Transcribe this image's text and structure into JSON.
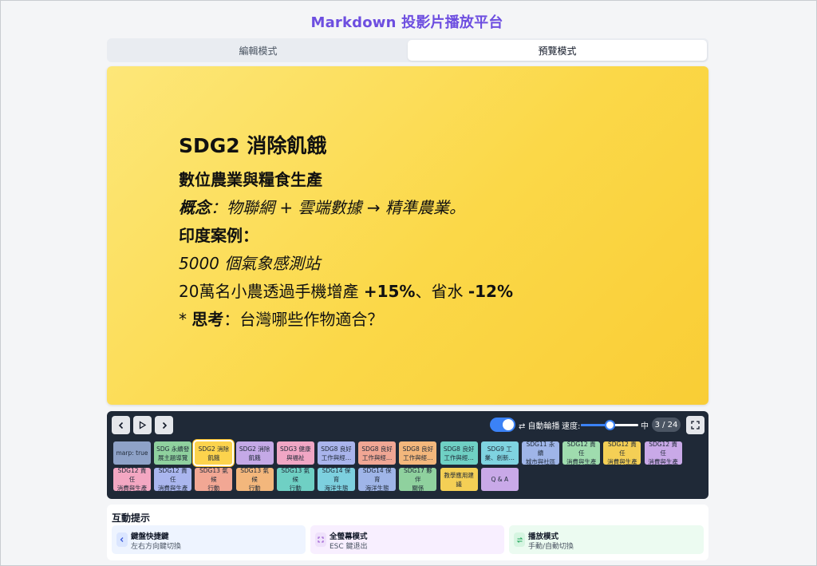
{
  "app": {
    "title": "Markdown 投影片播放平台"
  },
  "tabs": [
    {
      "label": "編輯模式",
      "active": false
    },
    {
      "label": "預覽模式",
      "active": true
    }
  ],
  "slide": {
    "heading": "SDG2 消除飢餓",
    "subheading": "數位農業與糧食生產",
    "concept_label": "概念",
    "concept_text": "：物聯網 + 雲端數據 → 精準農業。",
    "case_label": "印度案例：",
    "case_line1": "5000 個氣象感測站",
    "case_line2_prefix": "20萬名小農透過手機增產 ",
    "case_line2_bold1": "+15%",
    "case_line2_mid": "、省水 ",
    "case_line2_bold2": "-12%",
    "think_prefix": "* ",
    "think_label": "思考",
    "think_text": "：台灣哪些作物適合？",
    "background_color": "#fbd848"
  },
  "controls": {
    "prev_icon": "chevron-left-icon",
    "play_icon": "play-icon",
    "next_icon": "chevron-right-icon",
    "auto_play_on": true,
    "auto_play_label": "⇄ 自動輪播",
    "speed_label": "速度:",
    "speed_value": "中",
    "speed_level": 0.5,
    "counter": "3 / 24",
    "fullscreen_icon": "fullscreen-icon",
    "accent_color": "#3b82f6"
  },
  "thumbnails": [
    {
      "label": "marp: true",
      "color": "#8ea2c8",
      "active": false
    },
    {
      "label": "SDG 永續發\n展主題導覽",
      "color": "#8fd19e",
      "active": false
    },
    {
      "label": "SDG2 消除\n飢餓",
      "color": "#fcd34d",
      "active": true
    },
    {
      "label": "SDG2 消除\n飢餓",
      "color": "#c4a9e6",
      "active": false
    },
    {
      "label": "SDG3 健康\n與福祉",
      "color": "#f0a6c4",
      "active": false
    },
    {
      "label": "SDG8 良好\n工作與經…",
      "color": "#a9b4ec",
      "active": false
    },
    {
      "label": "SDG8 良好\n工作與經…",
      "color": "#f0a694",
      "active": false
    },
    {
      "label": "SDG8 良好\n工作與經…",
      "color": "#f3b77c",
      "active": false
    },
    {
      "label": "SDG8 良好\n工作與經…",
      "color": "#6fd0c4",
      "active": false
    },
    {
      "label": "SDG9 工\n業、創新…",
      "color": "#7fd3e0",
      "active": false
    },
    {
      "label": "SDG11 永續\n城市與社區",
      "color": "#9fb5e8",
      "active": false
    },
    {
      "label": "SDG12 責任\n消費與生產",
      "color": "#9fdcae",
      "active": false
    },
    {
      "label": "SDG12 責任\n消費與生產",
      "color": "#f4cf55",
      "active": false
    },
    {
      "label": "SDG12 責任\n消費與生產",
      "color": "#c9a9e8",
      "active": false
    },
    {
      "label": "SDG12 責任\n消費與生產",
      "color": "#f3a7c2",
      "active": false
    },
    {
      "label": "SDG12 責任\n消費與生產",
      "color": "#aab6ee",
      "active": false
    },
    {
      "label": "SDG13 氣候\n行動",
      "color": "#f2a794",
      "active": false
    },
    {
      "label": "SDG13 氣候\n行動",
      "color": "#f3b77c",
      "active": false
    },
    {
      "label": "SDG13 氣候\n行動",
      "color": "#6fd0c4",
      "active": false
    },
    {
      "label": "SDG14 保育\n海洋生態",
      "color": "#7dd0df",
      "active": false
    },
    {
      "label": "SDG14 保育\n海洋生態",
      "color": "#9fb5e8",
      "active": false
    },
    {
      "label": "SDG17 夥伴\n關係",
      "color": "#8fd19e",
      "active": false
    },
    {
      "label": "教學應用建\n議",
      "color": "#f4cf55",
      "active": false
    },
    {
      "label": "Q & A",
      "color": "#c9a9e8",
      "active": false
    }
  ],
  "tips": {
    "title": "互動提示",
    "items": [
      {
        "icon": "chevron-icon",
        "title": "鍵盤快捷鍵",
        "desc": "左右方向鍵切換",
        "bg": "#eef4ff",
        "icon_bg": "#dbe6ff",
        "icon_color": "#3b5bdb"
      },
      {
        "icon": "fullscreen-icon",
        "title": "全螢幕模式",
        "desc": "ESC 鍵退出",
        "bg": "#f8efff",
        "icon_bg": "#efe1fb",
        "icon_color": "#9b59d0"
      },
      {
        "icon": "repeat-icon",
        "title": "播放模式",
        "desc": "手動/自動切換",
        "bg": "#ecfbf1",
        "icon_bg": "#d6f5e1",
        "icon_color": "#22a55a"
      }
    ]
  }
}
